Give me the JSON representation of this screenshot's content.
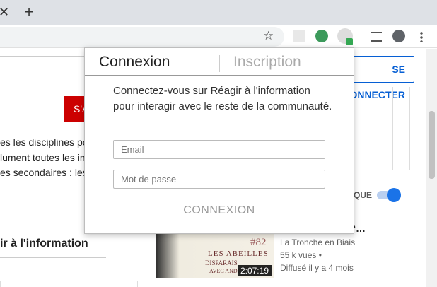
{
  "browser": {
    "tab_close_glyph": "✕",
    "new_tab_glyph": "+",
    "bookmark_glyph": "☆"
  },
  "page": {
    "se_connecter_label": "SE CONNECTER",
    "red_button_label": "S'A",
    "body_lines": [
      "es les disciplines po",
      "lument toutes les in",
      "es secondaires : les"
    ],
    "channel_heading": "ir à l'information",
    "autoplay_label": "QUE",
    "video": {
      "title": "es ?…",
      "channel": "La Tronche en Biais",
      "views": "55 k vues •",
      "aired": "Diffusé il y a 4 mois",
      "duration": "2:07:19",
      "thumb_text_1": "LES ABEILLES",
      "thumb_text_2": "DISPARAIS",
      "thumb_text_3": "AVEC ANDR",
      "thumb_number": "#82"
    }
  },
  "popup": {
    "tab_login": "Connexion",
    "tab_signup": "Inscription",
    "message": "Connectez-vous sur Réagir à l'information pour interagir avec le reste de la communauté.",
    "email_placeholder": "Email",
    "password_placeholder": "Mot de passe",
    "submit_label": "CONNEXION"
  },
  "colors": {
    "accent_blue": "#065fd4",
    "toggle_blue": "#1a73e8",
    "red_button": "#cc0000",
    "extension_green": "#34a853"
  }
}
